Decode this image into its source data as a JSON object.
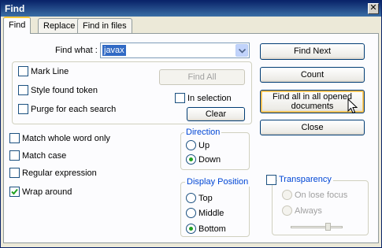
{
  "window": {
    "title": "Find"
  },
  "tabs": [
    {
      "label": "Find"
    },
    {
      "label": "Replace"
    },
    {
      "label": "Find in files"
    }
  ],
  "find_what": {
    "label": "Find what :",
    "value": "javax"
  },
  "buttons": {
    "find_next": "Find Next",
    "count": "Count",
    "find_all_opened_line1": "Find all in all opened",
    "find_all_opened_line2": "documents",
    "close": "Close",
    "find_all": "Find All",
    "clear": "Clear"
  },
  "options_top": {
    "mark_line": "Mark Line",
    "style_found_token": "Style found token",
    "purge_each_search": "Purge for each search",
    "in_selection": "In selection"
  },
  "options_bottom": {
    "match_whole_word": "Match whole word only",
    "match_case": "Match case",
    "regular_expression": "Regular expression",
    "wrap_around": "Wrap around"
  },
  "checked": {
    "mark_line": false,
    "style_found_token": false,
    "purge_each_search": false,
    "in_selection": false,
    "match_whole_word": false,
    "match_case": false,
    "regular_expression": false,
    "wrap_around": true,
    "transparency": false
  },
  "direction": {
    "title": "Direction",
    "options": [
      "Up",
      "Down"
    ],
    "selected": "Down"
  },
  "display_position": {
    "title": "Display Position",
    "options": [
      "Top",
      "Middle",
      "Bottom"
    ],
    "selected": "Bottom"
  },
  "transparency": {
    "title": "Transparency",
    "options": [
      "On lose focus",
      "Always"
    ],
    "selected": "On lose focus"
  }
}
